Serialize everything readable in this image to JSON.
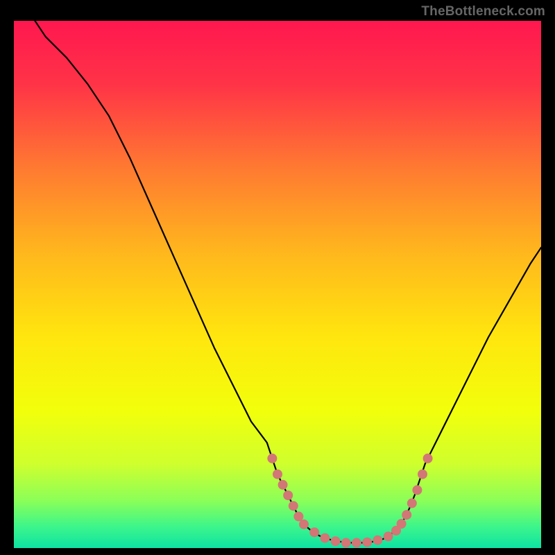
{
  "watermark": "TheBottleneck.com",
  "chart_data": {
    "type": "line",
    "title": "",
    "xlabel": "",
    "ylabel": "",
    "xlim": [
      0,
      100
    ],
    "ylim": [
      0,
      100
    ],
    "background": "gradient",
    "gradient": {
      "stops": [
        {
          "pct": 0,
          "color": "#ff174f"
        },
        {
          "pct": 12,
          "color": "#ff3347"
        },
        {
          "pct": 28,
          "color": "#ff7a31"
        },
        {
          "pct": 44,
          "color": "#ffb71d"
        },
        {
          "pct": 60,
          "color": "#ffe60e"
        },
        {
          "pct": 74,
          "color": "#f2ff0b"
        },
        {
          "pct": 84,
          "color": "#cfff2d"
        },
        {
          "pct": 91,
          "color": "#8bff58"
        },
        {
          "pct": 96,
          "color": "#3cf58b"
        },
        {
          "pct": 100,
          "color": "#0de3a3"
        }
      ]
    },
    "curve_color": "#000000",
    "marker_color": "#d37676",
    "curve_points": [
      {
        "x": 4,
        "y": 100
      },
      {
        "x": 6,
        "y": 97
      },
      {
        "x": 10,
        "y": 93
      },
      {
        "x": 14,
        "y": 88
      },
      {
        "x": 18,
        "y": 82
      },
      {
        "x": 22,
        "y": 74
      },
      {
        "x": 26,
        "y": 65
      },
      {
        "x": 30,
        "y": 56
      },
      {
        "x": 34,
        "y": 47
      },
      {
        "x": 38,
        "y": 38
      },
      {
        "x": 42,
        "y": 30
      },
      {
        "x": 45,
        "y": 24
      },
      {
        "x": 48,
        "y": 20
      },
      {
        "x": 49,
        "y": 17
      },
      {
        "x": 50,
        "y": 14
      },
      {
        "x": 51,
        "y": 12
      },
      {
        "x": 52,
        "y": 10
      },
      {
        "x": 53,
        "y": 8
      },
      {
        "x": 54,
        "y": 6
      },
      {
        "x": 55,
        "y": 4.5
      },
      {
        "x": 56.5,
        "y": 3.2
      },
      {
        "x": 58,
        "y": 2.3
      },
      {
        "x": 60,
        "y": 1.6
      },
      {
        "x": 62,
        "y": 1.2
      },
      {
        "x": 64,
        "y": 1.0
      },
      {
        "x": 66,
        "y": 1.0
      },
      {
        "x": 68,
        "y": 1.2
      },
      {
        "x": 70,
        "y": 1.7
      },
      {
        "x": 71.5,
        "y": 2.6
      },
      {
        "x": 73,
        "y": 4.0
      },
      {
        "x": 74,
        "y": 5.5
      },
      {
        "x": 75,
        "y": 7.5
      },
      {
        "x": 76,
        "y": 10
      },
      {
        "x": 77,
        "y": 13
      },
      {
        "x": 78,
        "y": 16
      },
      {
        "x": 80,
        "y": 20
      },
      {
        "x": 83,
        "y": 26
      },
      {
        "x": 86,
        "y": 32
      },
      {
        "x": 90,
        "y": 40
      },
      {
        "x": 94,
        "y": 47
      },
      {
        "x": 98,
        "y": 54
      },
      {
        "x": 100,
        "y": 57
      }
    ],
    "marker_points": [
      {
        "x": 49,
        "y": 17
      },
      {
        "x": 50,
        "y": 14
      },
      {
        "x": 51,
        "y": 12
      },
      {
        "x": 52,
        "y": 10
      },
      {
        "x": 53,
        "y": 8
      },
      {
        "x": 54,
        "y": 6
      },
      {
        "x": 55,
        "y": 4.5
      },
      {
        "x": 57,
        "y": 3.0
      },
      {
        "x": 59,
        "y": 1.9
      },
      {
        "x": 61,
        "y": 1.3
      },
      {
        "x": 63,
        "y": 1.0
      },
      {
        "x": 65,
        "y": 1.0
      },
      {
        "x": 67,
        "y": 1.1
      },
      {
        "x": 69,
        "y": 1.5
      },
      {
        "x": 71,
        "y": 2.2
      },
      {
        "x": 72.5,
        "y": 3.3
      },
      {
        "x": 73.5,
        "y": 4.6
      },
      {
        "x": 74.5,
        "y": 6.3
      },
      {
        "x": 75.5,
        "y": 8.5
      },
      {
        "x": 76.5,
        "y": 11
      },
      {
        "x": 77.5,
        "y": 14
      },
      {
        "x": 78.5,
        "y": 17
      }
    ]
  }
}
